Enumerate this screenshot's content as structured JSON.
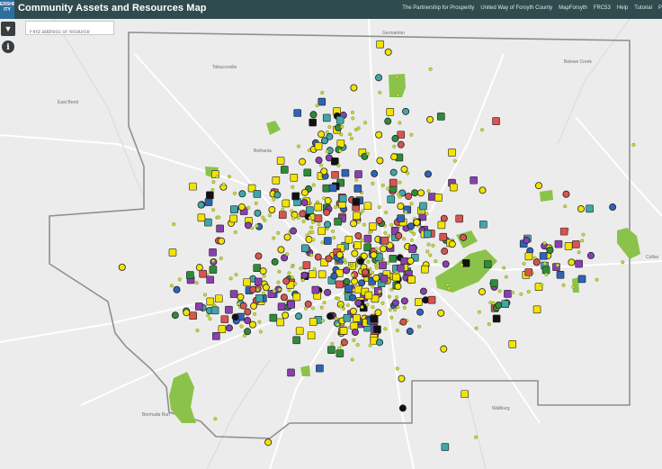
{
  "header": {
    "logo_text": "ERSHIP ITY",
    "title": "Community Assets and Resources Map",
    "nav": [
      "The Partnership for Prosperity",
      "United Way of Forsyth County",
      "MapForsyth",
      "FRC53",
      "Help",
      "Tutorial",
      "P"
    ]
  },
  "tools": {
    "menu_icon": "chevron-down-icon",
    "info_icon": "info-icon"
  },
  "search": {
    "placeholder": "Find address or resource"
  },
  "places": [
    "Germanton",
    "Tobaccoville",
    "Belews Creek",
    "East Bend",
    "Bethania",
    "Colfax",
    "Bermuda Run",
    "Wallburg"
  ],
  "colors": {
    "header": "#2f4b4d",
    "park_green": "#8bc34a",
    "food_yellow": "#f2e400",
    "health_purple": "#8a3fb0",
    "housing_blue": "#2f63b5",
    "library_teal": "#3fa7a8",
    "small_dot": "#c7d93a"
  }
}
